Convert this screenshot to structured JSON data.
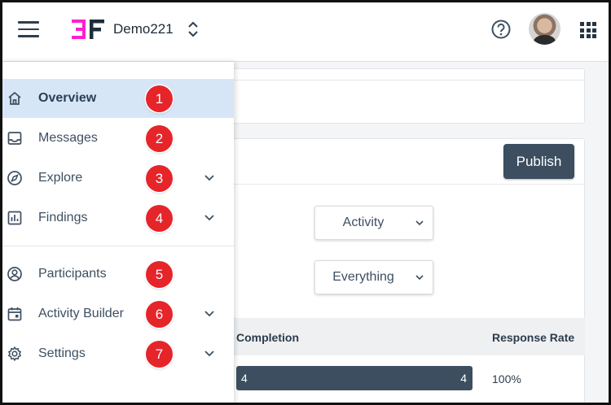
{
  "header": {
    "project_name": "Demo221",
    "brand_color": "#ff1fd1",
    "dark_color": "#1f2d3a"
  },
  "sidebar": {
    "items": [
      {
        "label": "Overview",
        "icon": "home-icon",
        "badge": "1",
        "expandable": false,
        "active": true
      },
      {
        "label": "Messages",
        "icon": "inbox-icon",
        "badge": "2",
        "expandable": false
      },
      {
        "label": "Explore",
        "icon": "compass-icon",
        "badge": "3",
        "expandable": true
      },
      {
        "label": "Findings",
        "icon": "bar-chart-icon",
        "badge": "4",
        "expandable": true
      },
      {
        "label": "Participants",
        "icon": "user-circle-icon",
        "badge": "5",
        "expandable": false
      },
      {
        "label": "Activity Builder",
        "icon": "calendar-icon",
        "badge": "6",
        "expandable": true
      },
      {
        "label": "Settings",
        "icon": "gear-icon",
        "badge": "7",
        "expandable": true
      }
    ]
  },
  "main": {
    "publish_label": "Publish",
    "activity_select": {
      "value": "Activity"
    },
    "scope_select": {
      "value": "Everything"
    },
    "table": {
      "columns": [
        "Completion",
        "Response Rate"
      ],
      "row": {
        "completion_left": "4",
        "completion_right": "4",
        "response_rate": "100%"
      }
    }
  }
}
